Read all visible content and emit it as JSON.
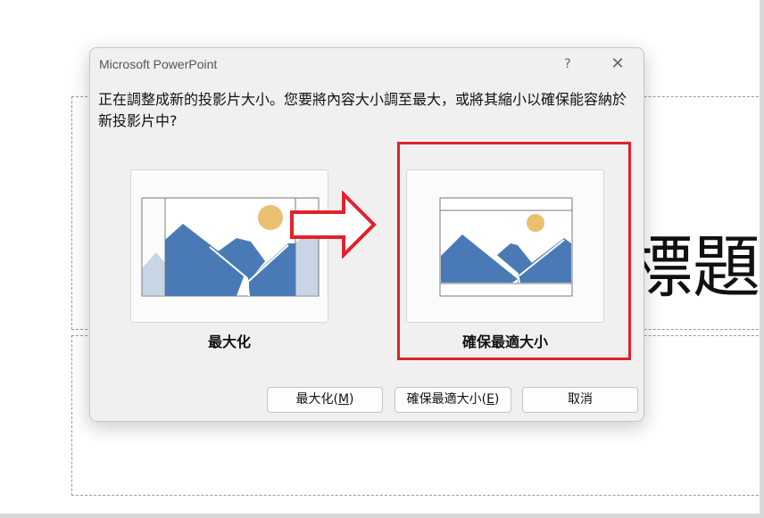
{
  "slide": {
    "title_fragment": "標題"
  },
  "dialog": {
    "title": "Microsoft PowerPoint",
    "help_label": "?",
    "close_label": "✕",
    "message": "正在調整成新的投影片大小。您要將內容大小調至最大，或將其縮小以確保能容納於新投影片中?",
    "options": [
      {
        "label": "最大化"
      },
      {
        "label": "確保最適大小"
      }
    ],
    "buttons": {
      "maximize": {
        "text": "最大化(",
        "key": "M",
        "close": ")"
      },
      "ensure_fit": {
        "text": "確保最適大小(",
        "key": "E",
        "close": ")"
      },
      "cancel": {
        "text": "取消"
      }
    }
  },
  "colors": {
    "mountain": "#4a7ab5",
    "mountain_faded": "#c7d5e7",
    "sun": "#e9c06f",
    "highlight": "#e0222b"
  }
}
